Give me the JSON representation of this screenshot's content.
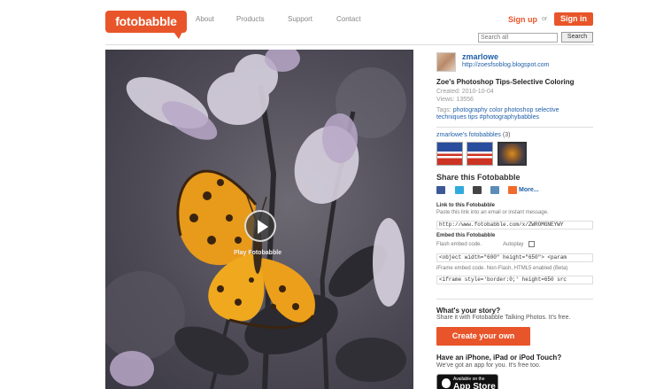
{
  "header": {
    "logo_text": "fotobabble",
    "nav": [
      "About",
      "Products",
      "Support",
      "Contact"
    ],
    "signup_label": "Sign up",
    "or_text": "or",
    "signin_label": "Sign in",
    "search_placeholder": "Search all",
    "search_button": "Search"
  },
  "photo": {
    "play_label": "Play Fotobabble"
  },
  "sidebar": {
    "username": "zmarlowe",
    "user_link": "http://zoesfsoblog.blogspot.com",
    "title": "Zoe's Photoshop Tips-Selective Coloring",
    "created": "Created: 2010-10-04",
    "views": "Views: 13556",
    "tags_label": "Tags:",
    "tags_line1": "photography color photoshop selective",
    "tags_line2": "techniques tips #photographybabbles",
    "collection_label": "zmarlowe's fotobabbles",
    "collection_count": "(3)",
    "share_title": "Share this Fotobabble",
    "share_more": "More...",
    "link_head": "Link to this Fotobabble",
    "link_sub": "Paste this link into an email or instant message.",
    "link_value": "http://www.fotobabble.com/x/ZWROMGNEYWY",
    "embed_head": "Embed this Fotobabble",
    "embed_sub": "Flash embed code.",
    "autoplay_label": "Autoplay",
    "embed_value": "<object width=\"600\" height=\"650\"> <param",
    "iframe_sub": "iFrame embed code. Non-Flash, HTML5 enabled (Beta)",
    "iframe_value": "<iframe style='border:0;' height=650 src",
    "story_head": "What's your story?",
    "story_sub": "Share it with Fotobabble Talking Photos. It's free.",
    "create_button": "Create your own",
    "iphone_head": "Have an iPhone, iPad or iPod Touch?",
    "iphone_sub": "We've got an app for you. It's free too.",
    "appstore_small": "Available on the",
    "appstore_big": "App Store"
  },
  "colors": {
    "brand": "#e8552a",
    "link": "#1f5fa8"
  }
}
